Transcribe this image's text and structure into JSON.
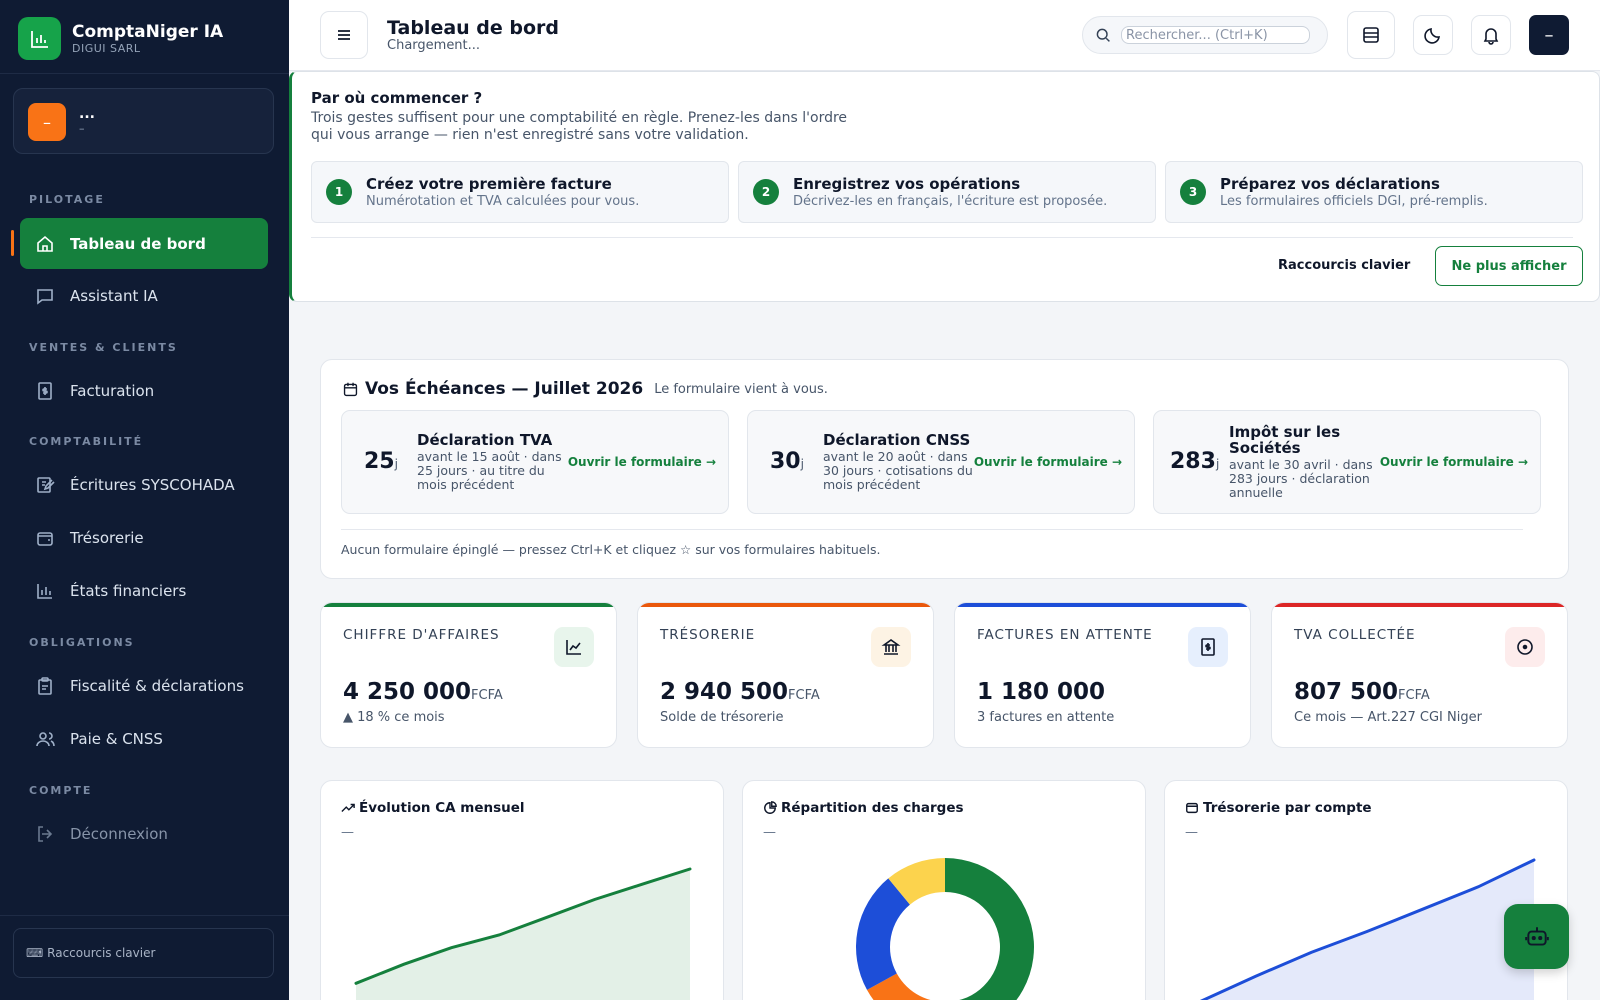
{
  "sidebar": {
    "brand_name": "ComptaNiger IA",
    "brand_sub": "DIGUI SARL",
    "company_badge": "–",
    "company_name": "...",
    "company_sub": "–",
    "sections": {
      "pilotage": "PILOTAGE",
      "ventes": "VENTES & CLIENTS",
      "compta": "COMPTABILITÉ",
      "obligations": "OBLIGATIONS",
      "compte": "COMPTE"
    },
    "items": {
      "dashboard": "Tableau de bord",
      "assistant": "Assistant IA",
      "facturation": "Facturation",
      "ecritures": "Écritures SYSCOHADA",
      "tresorerie": "Trésorerie",
      "etats": "États financiers",
      "fiscalite": "Fiscalité & déclarations",
      "paie": "Paie & CNSS",
      "deconnexion": "Déconnexion"
    },
    "shortcuts": "⌨ Raccourcis clavier"
  },
  "topbar": {
    "title": "Tableau de bord",
    "subtitle": "Chargement...",
    "search_placeholder": "Rechercher... (Ctrl+K)",
    "user_button": "–"
  },
  "onboarding": {
    "title": "Par où commencer ?",
    "description": "Trois gestes suffisent pour une comptabilité en règle. Prenez-les dans l'ordre qui vous arrange — rien n'est enregistré sans votre validation.",
    "steps": [
      {
        "num": "1",
        "title": "Créez votre première facture",
        "desc": "Numérotation et TVA calculées pour vous."
      },
      {
        "num": "2",
        "title": "Enregistrez vos opérations",
        "desc": "Décrivez-les en français, l'écriture est proposée."
      },
      {
        "num": "3",
        "title": "Préparez vos déclarations",
        "desc": "Les formulaires officiels DGI, pré-remplis."
      }
    ],
    "shortcuts_link": "Raccourcis clavier",
    "dismiss_button": "Ne plus afficher"
  },
  "echeances": {
    "title": "Vos Échéances — Juillet 2026",
    "note": "Le formulaire vient à vous.",
    "items": [
      {
        "days": "25",
        "unit": "j",
        "title": "Déclaration TVA",
        "desc": "avant le 15 août · dans 25 jours · au titre du mois précédent",
        "link": "Ouvrir le formulaire →"
      },
      {
        "days": "30",
        "unit": "j",
        "title": "Déclaration CNSS",
        "desc": "avant le 20 août · dans 30 jours · cotisations du mois précédent",
        "link": "Ouvrir le formulaire →"
      },
      {
        "days": "283",
        "unit": "j",
        "title": "Impôt sur les Sociétés",
        "desc": "avant le 30 avril · dans 283 jours · déclaration annuelle",
        "link": "Ouvrir le formulaire →"
      }
    ],
    "footer": "Aucun formulaire épinglé — pressez Ctrl+K et cliquez ☆ sur vos formulaires habituels."
  },
  "kpis": [
    {
      "label": "CHIFFRE D'AFFAIRES",
      "value": "4 250 000",
      "unit": "FCFA",
      "sub": "▲ 18 % ce mois",
      "color": "#15803d",
      "icon_bg": "#e8f5ec",
      "icon": "chart-icon"
    },
    {
      "label": "TRÉSORERIE",
      "value": "2 940 500",
      "unit": "FCFA",
      "sub": "Solde de trésorerie",
      "color": "#ea580c",
      "icon_bg": "#fdf3e4",
      "icon": "bank-icon"
    },
    {
      "label": "FACTURES EN ATTENTE",
      "value": "1 180 000",
      "unit": "",
      "sub": "3 factures en attente",
      "color": "#1d4ed8",
      "icon_bg": "#e6effd",
      "icon": "invoice-icon"
    },
    {
      "label": "TVA COLLECTÉE",
      "value": "807 500",
      "unit": "FCFA",
      "sub": "Ce mois — Art.227 CGI Niger",
      "color": "#dc2626",
      "icon_bg": "#fdecec",
      "icon": "tax-icon"
    }
  ],
  "charts": {
    "ca": {
      "title": "Évolution CA mensuel",
      "placeholder": "—"
    },
    "charges": {
      "title": "Répartition des charges",
      "placeholder": "—"
    },
    "treso": {
      "title": "Trésorerie par compte",
      "placeholder": "—"
    }
  },
  "chart_data": [
    {
      "type": "area",
      "title": "Évolution CA mensuel",
      "series": [
        {
          "values": [
            10,
            25,
            38,
            48,
            62,
            76,
            88,
            100
          ]
        }
      ],
      "color": "#15803d"
    },
    {
      "type": "pie",
      "title": "Répartition des charges",
      "values": [
        48,
        19,
        22,
        11
      ],
      "colors": [
        "#15803d",
        "#f97316",
        "#1d4ed8",
        "#fcd34d"
      ]
    },
    {
      "type": "area",
      "title": "Trésorerie par compte",
      "series": [
        {
          "values": [
            5,
            22,
            38,
            52,
            67,
            82,
            100
          ]
        }
      ],
      "color": "#1d4ed8"
    }
  ]
}
